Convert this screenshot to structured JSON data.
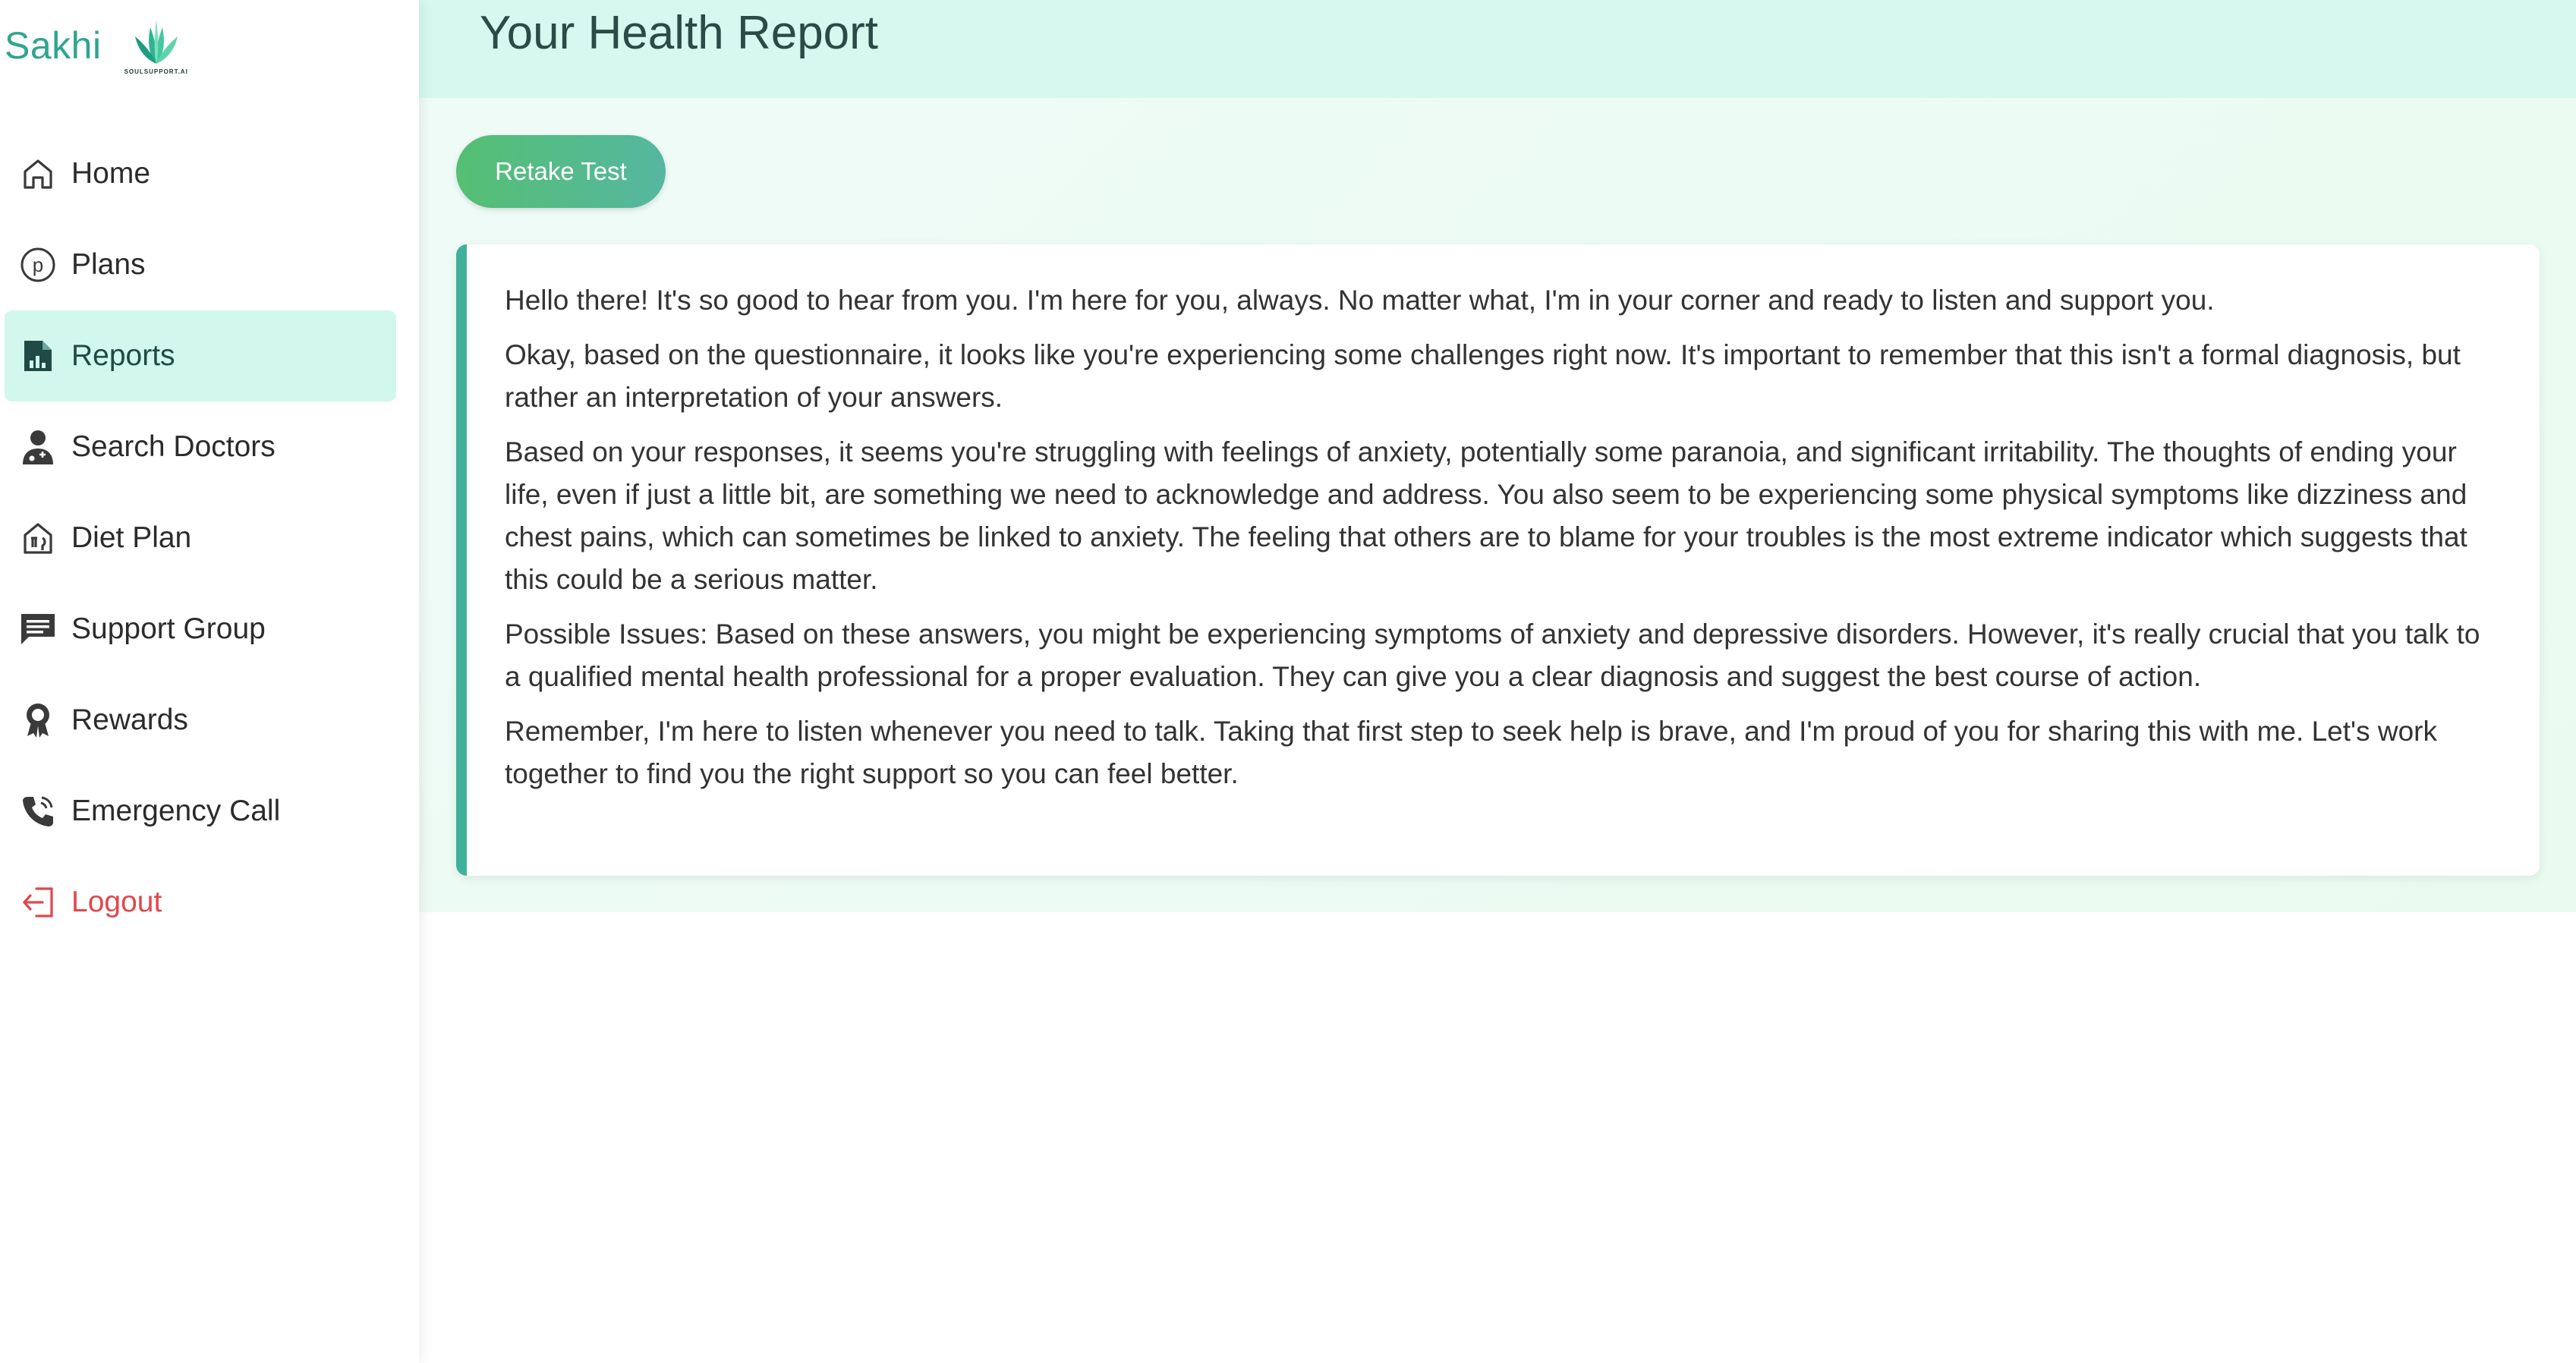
{
  "brand": {
    "name": "Sakhi",
    "logo_caption": "SOULSUPPORT.AI"
  },
  "sidebar": {
    "items": [
      {
        "label": "Home",
        "icon": "home-icon"
      },
      {
        "label": "Plans",
        "icon": "plans-p-icon"
      },
      {
        "label": "Reports",
        "icon": "report-chart-icon",
        "active": true
      },
      {
        "label": "Search Doctors",
        "icon": "doctor-icon"
      },
      {
        "label": "Diet Plan",
        "icon": "diet-house-icon"
      },
      {
        "label": "Support Group",
        "icon": "chat-icon"
      },
      {
        "label": "Rewards",
        "icon": "award-icon"
      },
      {
        "label": "Emergency Call",
        "icon": "phone-icon"
      },
      {
        "label": "Logout",
        "icon": "logout-icon"
      }
    ]
  },
  "header": {
    "title": "Your Health Report"
  },
  "actions": {
    "retake_label": "Retake Test"
  },
  "report": {
    "paragraphs": [
      "Hello there! It's so good to hear from you. I'm here for you, always. No matter what, I'm in your corner and ready to listen and support you.",
      "Okay, based on the questionnaire, it looks like you're experiencing some challenges right now. It's important to remember that this isn't a formal diagnosis, but rather an interpretation of your answers.",
      "Based on your responses, it seems you're struggling with feelings of anxiety, potentially some paranoia, and significant irritability. The thoughts of ending your life, even if just a little bit, are something we need to acknowledge and address. You also seem to be experiencing some physical symptoms like dizziness and chest pains, which can sometimes be linked to anxiety. The feeling that others are to blame for your troubles is the most extreme indicator which suggests that this could be a serious matter.",
      "Possible Issues: Based on these answers, you might be experiencing symptoms of anxiety and depressive disorders. However, it's really crucial that you talk to a qualified mental health professional for a proper evaluation. They can give you a clear diagnosis and suggest the best course of action.",
      "Remember, I'm here to listen whenever you need to talk. Taking that first step to seek help is brave, and I'm proud of you for sharing this with me. Let's work together to find you the right support so you can feel better."
    ]
  },
  "colors": {
    "accent": "#3fb19a",
    "active_nav_bg": "#d2f7ec",
    "header_bg": "#d6f8ef",
    "logout": "#e0474c",
    "button_gradient_start": "#55bf73",
    "button_gradient_end": "#55b7a0"
  }
}
